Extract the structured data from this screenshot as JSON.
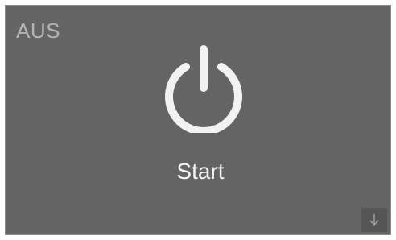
{
  "status": {
    "label": "AUS"
  },
  "power": {
    "label": "Start",
    "icon": "power-icon"
  },
  "navigation": {
    "scroll_icon": "arrow-down-icon"
  },
  "colors": {
    "background": "#646464",
    "icon": "#f2f2f2",
    "status_text": "#b4b4b4",
    "button_bg": "#555555"
  }
}
